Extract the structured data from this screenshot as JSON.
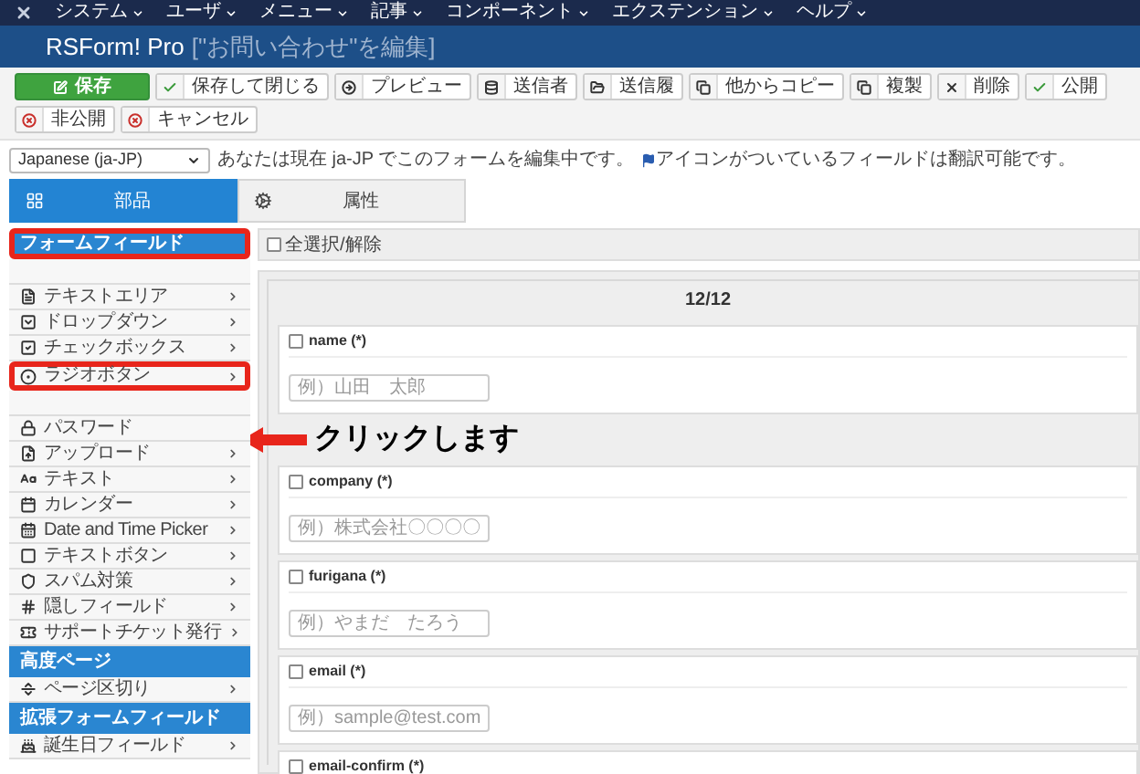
{
  "menu_bar": {
    "items": [
      "システム",
      "ユーザ",
      "メニュー",
      "記事",
      "コンポーネント",
      "エクステンション",
      "ヘルプ"
    ]
  },
  "title_bar": {
    "app": "RSForm! Pro",
    "subtitle": "[\"お問い合わせ\"を編集]"
  },
  "toolbar": [
    {
      "label": "保存",
      "kind": "primary"
    },
    {
      "label": "保存して閉じる",
      "kind": "default"
    },
    {
      "label": "プレビュー",
      "kind": "default"
    },
    {
      "label": "送信者",
      "kind": "default"
    },
    {
      "label": "送信履",
      "kind": "default"
    },
    {
      "label": "他からコピー",
      "kind": "default"
    },
    {
      "label": "複製",
      "kind": "default"
    },
    {
      "label": "削除",
      "kind": "default"
    },
    {
      "label": "公開",
      "kind": "default"
    },
    {
      "label": "非公開",
      "kind": "default"
    },
    {
      "label": "キャンセル",
      "kind": "default"
    }
  ],
  "language": {
    "value": "Japanese (ja-JP)",
    "notice_1": "あなたは現在 ja-JP でこのフォームを編集中です。",
    "notice_2": "アイコンがついているフィールドは翻訳可能です。"
  },
  "tabs": [
    {
      "label": "部品",
      "selected": true
    },
    {
      "label": "属性",
      "selected": false
    }
  ],
  "sidebar": {
    "items": [
      {
        "kind": "section",
        "label": "フォームフィールド",
        "highlighted": true
      },
      {
        "kind": "covered"
      },
      {
        "kind": "item",
        "label": "テキストエリア",
        "submenu": true,
        "highlighted": false
      },
      {
        "kind": "item",
        "label": "ドロップダウン",
        "submenu": true,
        "highlighted": false
      },
      {
        "kind": "item",
        "label": "チェックボックス",
        "submenu": true,
        "highlighted": false
      },
      {
        "kind": "item",
        "label": "ラジオボタン",
        "submenu": true,
        "highlighted": true
      },
      {
        "kind": "covered"
      },
      {
        "kind": "item",
        "label": "パスワード",
        "submenu": false,
        "highlighted": false
      },
      {
        "kind": "item",
        "label": "アップロード",
        "submenu": true,
        "highlighted": false
      },
      {
        "kind": "item",
        "label": "テキスト",
        "submenu": true,
        "highlighted": false
      },
      {
        "kind": "item",
        "label": "カレンダー",
        "submenu": true,
        "highlighted": false
      },
      {
        "kind": "item",
        "label": "Date and Time Picker",
        "submenu": true,
        "highlighted": false
      },
      {
        "kind": "item",
        "label": "テキストボタン",
        "submenu": true,
        "highlighted": false
      },
      {
        "kind": "item",
        "label": "スパム対策",
        "submenu": true,
        "highlighted": false
      },
      {
        "kind": "item",
        "label": "隠しフィールド",
        "submenu": true,
        "highlighted": false
      },
      {
        "kind": "item",
        "label": "サポートチケット発行",
        "submenu": true,
        "highlighted": false
      },
      {
        "kind": "section",
        "label": "高度ページ",
        "highlighted": false
      },
      {
        "kind": "item",
        "label": "ページ区切り",
        "submenu": true,
        "highlighted": false
      },
      {
        "kind": "section",
        "label": "拡張フォームフィールド",
        "highlighted": false
      },
      {
        "kind": "item",
        "label": "誕生日フィールド",
        "submenu": true,
        "highlighted": false
      }
    ]
  },
  "callout": {
    "text": "クリックします"
  },
  "select_all": {
    "label": "全選択/解除",
    "checked": false
  },
  "form_panel": {
    "heading": "12/12",
    "fields": [
      {
        "label": "name (*)",
        "checked": false,
        "placeholder": "例）山田　太郎"
      },
      {
        "label": "company (*)",
        "checked": false,
        "placeholder": "例）株式会社〇〇〇〇"
      },
      {
        "label": "furigana (*)",
        "checked": false,
        "placeholder": "例）やまだ　たろう"
      },
      {
        "label": "email (*)",
        "checked": false,
        "placeholder": "例）sample@test.com"
      },
      {
        "label": "email-confirm (*)",
        "checked": false
      }
    ]
  }
}
